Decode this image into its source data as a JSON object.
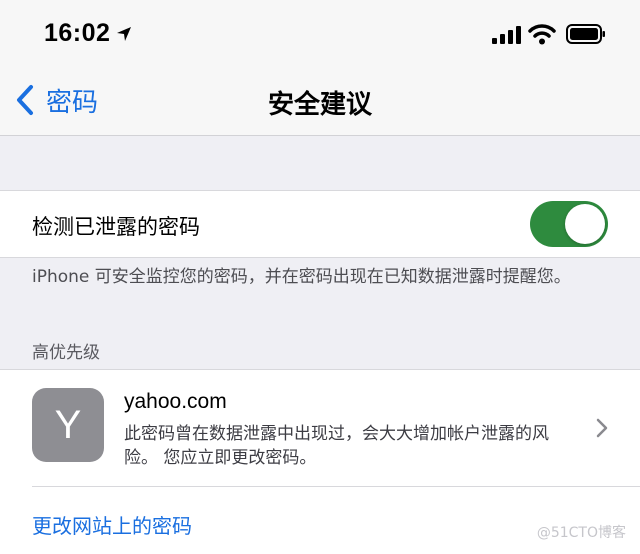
{
  "status_bar": {
    "time": "16:02",
    "icons": [
      "location-arrow-icon",
      "signal-icon",
      "wifi-icon",
      "battery-icon"
    ]
  },
  "nav": {
    "back_label": "密码",
    "title": "安全建议"
  },
  "detect_setting": {
    "label": "检测已泄露的密码",
    "enabled": true
  },
  "detect_footer": "iPhone 可安全监控您的密码，并在密码出现在已知数据泄露时提醒您。",
  "priority_section": {
    "header": "高优先级",
    "items": [
      {
        "avatar_letter": "Y",
        "site": "yahoo.com",
        "description": "此密码曾在数据泄露中出现过，会大大增加帐户泄露的风险。 您应立即更改密码。"
      }
    ],
    "action_label": "更改网站上的密码"
  },
  "watermark": "@51CTO博客",
  "colors": {
    "accent": "#1a6fe0",
    "toggle_on": "#2e8b3e",
    "avatar_bg": "#8e8e93",
    "background": "#efeff4"
  }
}
